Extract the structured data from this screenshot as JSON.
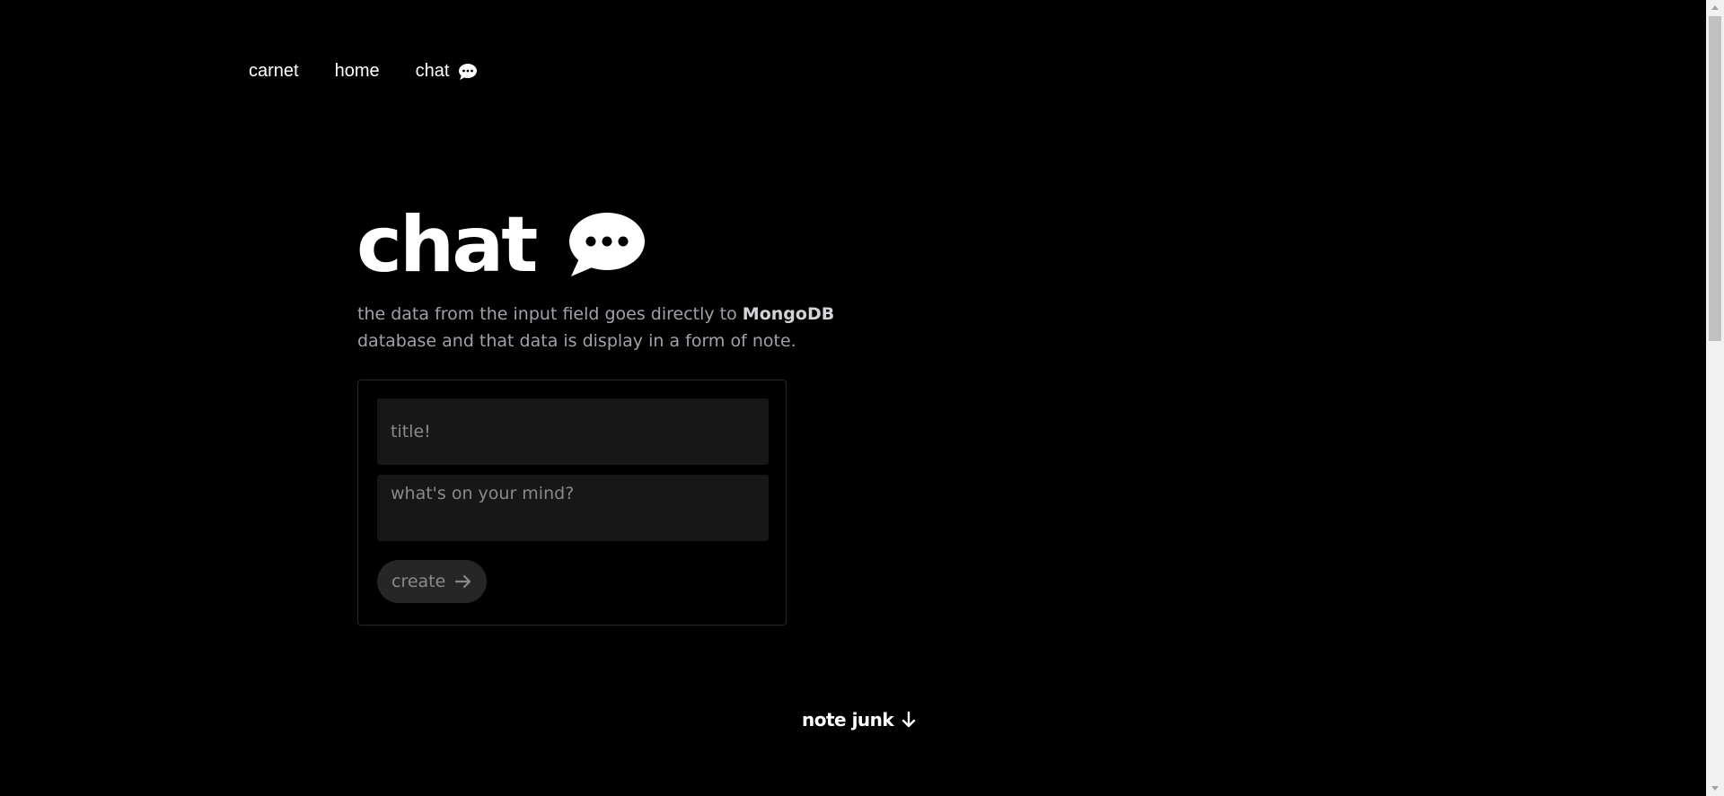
{
  "nav": {
    "items": [
      {
        "label": "carnet"
      },
      {
        "label": "home"
      },
      {
        "label": "chat",
        "icon": "speech-bubble-icon"
      }
    ]
  },
  "hero": {
    "title": "chat",
    "icon": "speech-bubble-icon",
    "description_prefix": "the data from the input field goes directly to ",
    "description_emphasis": "MongoDB",
    "description_suffix": " database and that data is display in a form of note."
  },
  "form": {
    "title_placeholder": "title!",
    "title_value": "",
    "body_placeholder": "what's on your mind?",
    "body_value": "",
    "create_label": "create",
    "create_icon": "arrow-right-icon"
  },
  "footer": {
    "note_junk_label": "note junk",
    "note_junk_icon": "arrow-down-icon"
  },
  "colors": {
    "background": "#000000",
    "text_primary": "#ffffff",
    "text_muted": "#a1a1aa",
    "field_bg": "#171717",
    "button_bg": "#262626"
  }
}
